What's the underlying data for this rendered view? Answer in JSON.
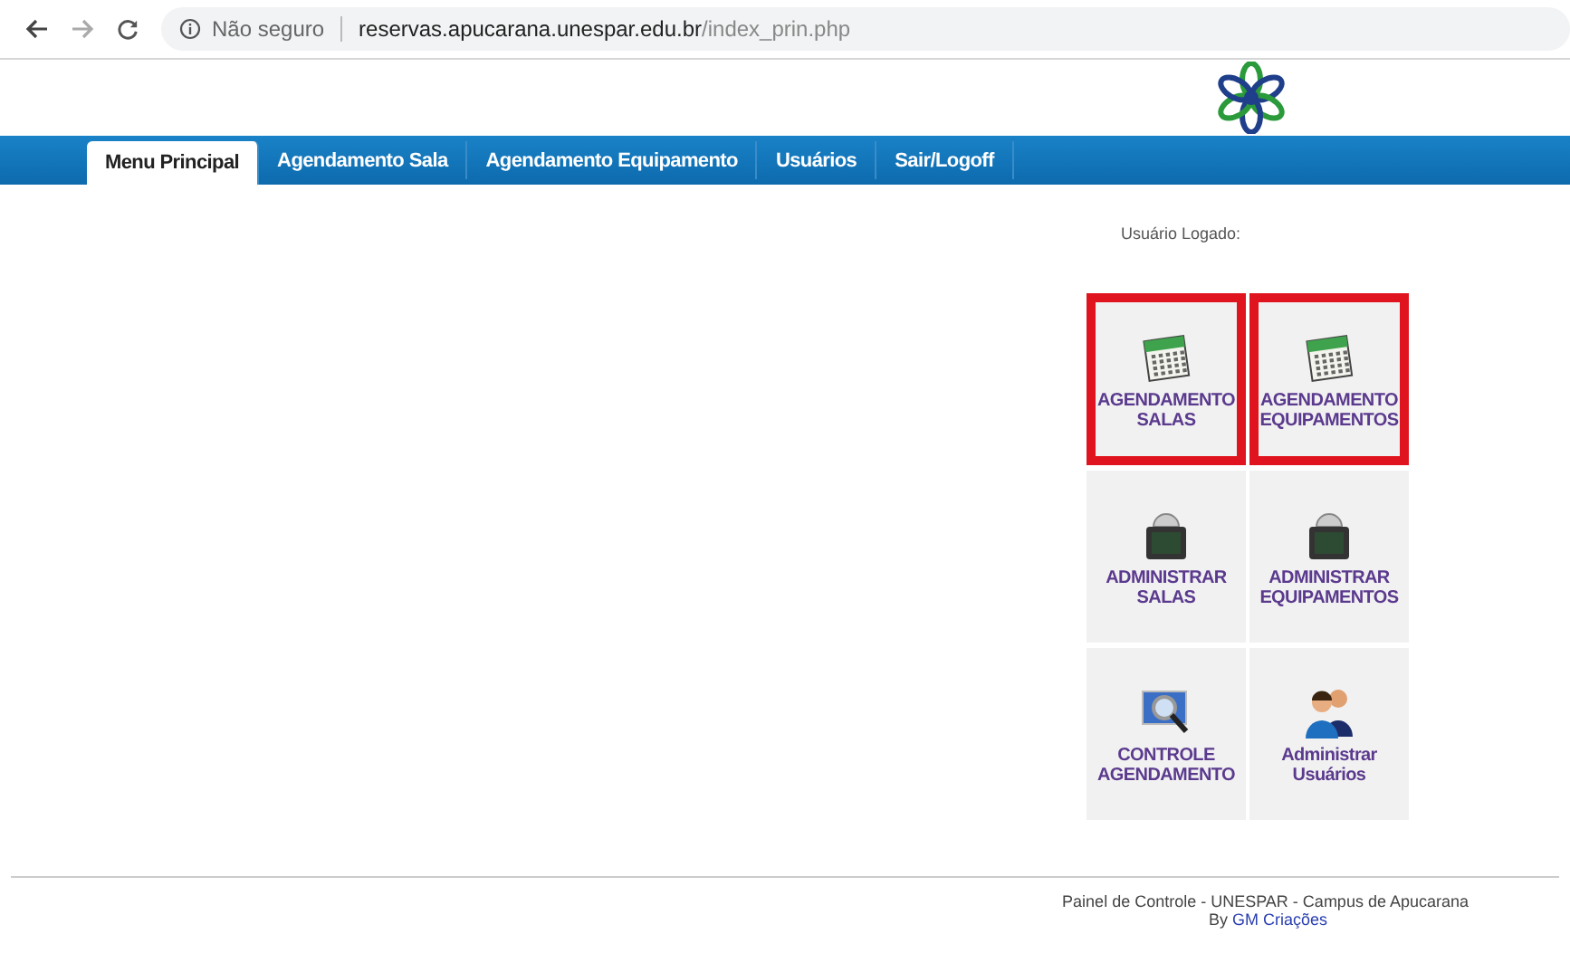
{
  "browser": {
    "security": "Não seguro",
    "url_host": "reservas.apucarana.unespar.edu.br",
    "url_path": "/index_prin.php"
  },
  "tabs": [
    {
      "label": "Menu Principal",
      "selected": true
    },
    {
      "label": "Agendamento Sala",
      "selected": false
    },
    {
      "label": "Agendamento Equipamento",
      "selected": false
    },
    {
      "label": "Usuários",
      "selected": false
    },
    {
      "label": "Sair/Logoff",
      "selected": false
    }
  ],
  "user_label": "Usuário Logado:",
  "tiles": [
    {
      "kind": "calendar",
      "lines": [
        "AGENDAMENTO",
        "SALAS"
      ],
      "highlighted": true
    },
    {
      "kind": "calendar",
      "lines": [
        "AGENDAMENTO",
        "EQUIPAMENTOS"
      ],
      "highlighted": true
    },
    {
      "kind": "monitor",
      "lines": [
        "ADMINISTRAR",
        "SALAS"
      ],
      "highlighted": false
    },
    {
      "kind": "monitor",
      "lines": [
        "ADMINISTRAR",
        "EQUIPAMENTOS"
      ],
      "highlighted": false
    },
    {
      "kind": "search",
      "lines": [
        "CONTROLE",
        "AGENDAMENTO"
      ],
      "highlighted": false
    },
    {
      "kind": "users",
      "lines": [
        "Administrar",
        "Usuários"
      ],
      "highlighted": false
    }
  ],
  "footer": {
    "text": "Painel de Controle - UNESPAR - Campus de Apucarana",
    "by": "By",
    "link": "GM Criações"
  }
}
